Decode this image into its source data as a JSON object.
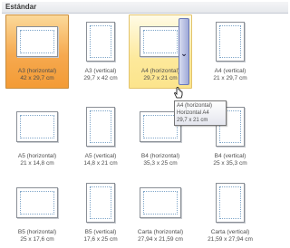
{
  "section": {
    "title": "Estándar"
  },
  "items": [
    {
      "name": "A3 (horizontal)",
      "size": "42 x 29,7 cm",
      "orientation": "horizontal",
      "state": "selected"
    },
    {
      "name": "A3 (vertical)",
      "size": "29,7 x 42 cm",
      "orientation": "vertical",
      "state": "normal"
    },
    {
      "name": "A4 (horizontal)",
      "size": "29,7 x 21 cm",
      "orientation": "horizontal",
      "state": "hover"
    },
    {
      "name": "A4 (vertical)",
      "size": "21 x 29,7 cm",
      "orientation": "vertical",
      "state": "normal"
    },
    {
      "name": "A5 (horizontal)",
      "size": "21 x 14,8 cm",
      "orientation": "horizontal",
      "state": "normal"
    },
    {
      "name": "A5 (vertical)",
      "size": "14,8 x 21 cm",
      "orientation": "vertical",
      "state": "normal"
    },
    {
      "name": "B4 (horizontal)",
      "size": "35,3 x 25 cm",
      "orientation": "horizontal",
      "state": "normal"
    },
    {
      "name": "B4 (vertical)",
      "size": "25 x 35,3 cm",
      "orientation": "vertical",
      "state": "normal"
    },
    {
      "name": "B5 (horizontal)",
      "size": "25 x 17,6 cm",
      "orientation": "horizontal",
      "state": "normal"
    },
    {
      "name": "B5 (vertical)",
      "size": "17,6 x 25 cm",
      "orientation": "vertical",
      "state": "normal"
    },
    {
      "name": "Carta (horizontal)",
      "size": "27,94 x 21,59 cm",
      "orientation": "horizontal",
      "state": "normal"
    },
    {
      "name": "Carta (vertical)",
      "size": "21,59 x 27,94 cm",
      "orientation": "vertical",
      "state": "normal"
    }
  ],
  "scroll_button": {
    "icon": "chevron-down-icon",
    "glyph": "⌄"
  },
  "tooltip": {
    "line1": "A4 (horizontal)",
    "line2": "Horizontal A4",
    "line3": "29,7 x 21 cm"
  },
  "colors": {
    "selected": "#f6a94f",
    "hover": "#fde99b",
    "margin_guide": "#7fa6c9"
  }
}
